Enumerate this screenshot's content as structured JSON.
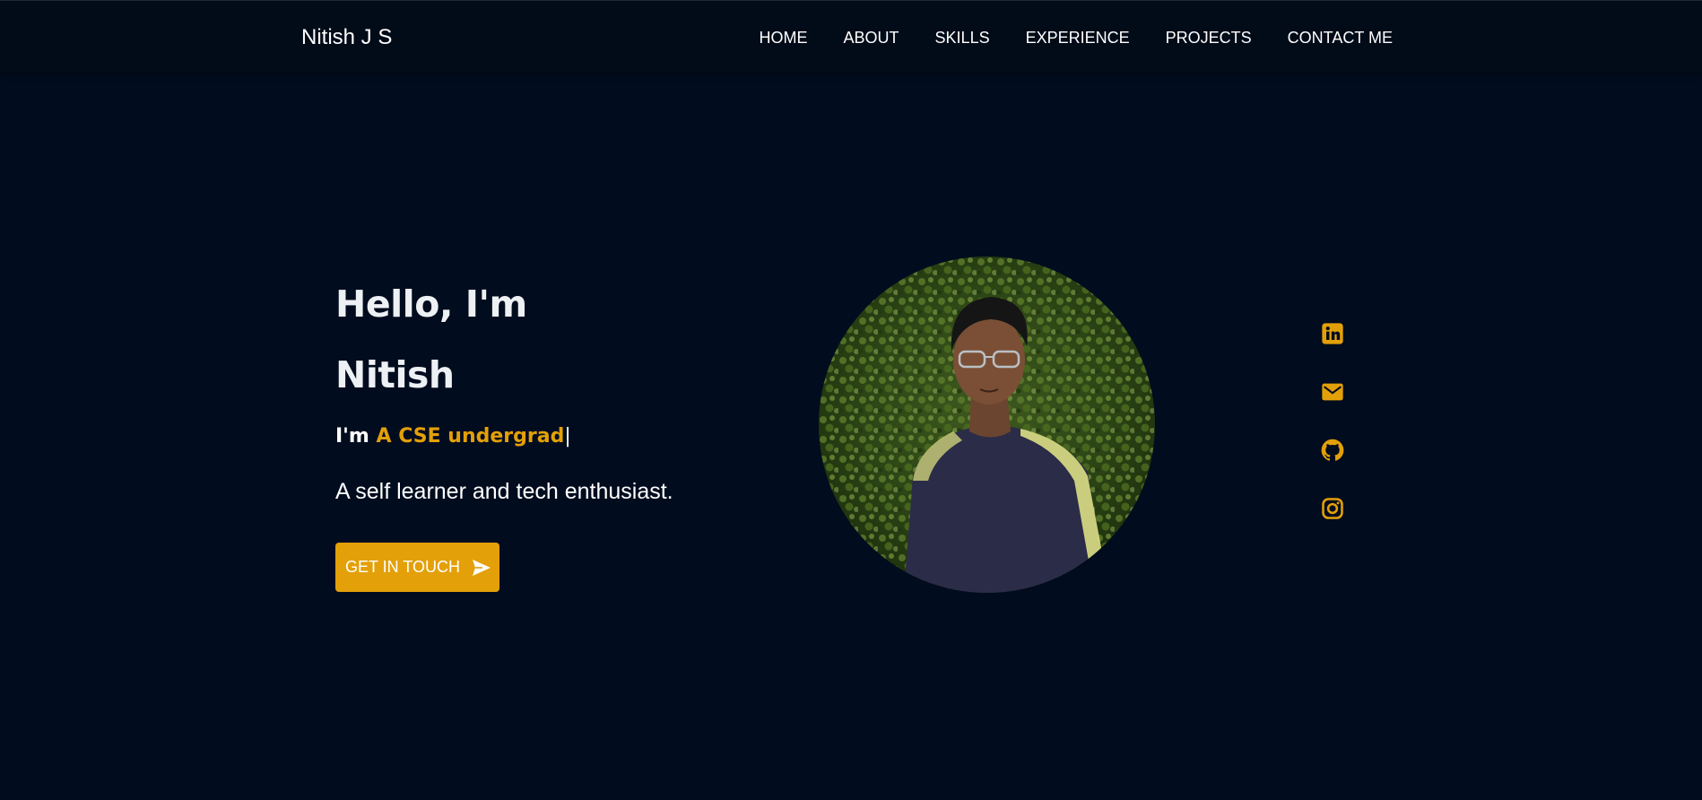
{
  "navbar": {
    "brand": "Nitish J S",
    "links": [
      "HOME",
      "ABOUT",
      "SKILLS",
      "EXPERIENCE",
      "PROJECTS",
      "CONTACT ME"
    ]
  },
  "hero": {
    "greeting": "Hello, I'm",
    "name": "Nitish",
    "typed_prefix": "I'm ",
    "typed_highlight": "A CSE undergrad",
    "typed_cursor": "|",
    "tagline": "A self learner and tech enthusiast.",
    "cta_label": "GET IN TOUCH",
    "cta_icon": "send-icon"
  },
  "social": {
    "icons": [
      "linkedin-icon",
      "mail-icon",
      "github-icon",
      "instagram-icon"
    ]
  },
  "colors": {
    "background": "#010c1e",
    "navbar": "#020b18",
    "accent": "#e3a008",
    "text": "#ffffff"
  }
}
